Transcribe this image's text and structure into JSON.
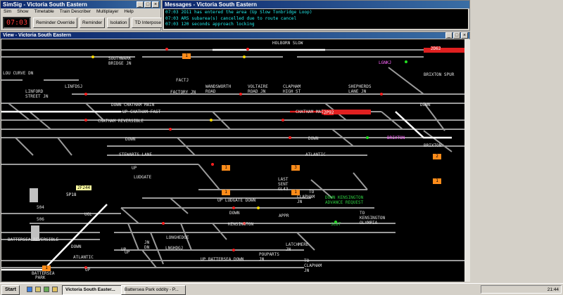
{
  "main_window": {
    "title": "SimSig - Victoria South Eastern",
    "menu": [
      "Sim",
      "Show",
      "Timetable",
      "Train Describer",
      "Multiplayer",
      "Help"
    ],
    "clock": "07:03",
    "buttons": [
      "Reminder Override",
      "Reminder",
      "Isolation",
      "TD Interpose"
    ]
  },
  "messages_window": {
    "title": "Messages - Victoria South Eastern",
    "lines": [
      "07:03 2O11 has entered the area (Up Slow Tonbridge Loop)",
      "07:03 AR5 subarea(s) cancelled due to route cancel",
      "07:03 120 seconds approach locking"
    ]
  },
  "view_window": {
    "title": "View - Victoria South Eastern"
  },
  "diagram": {
    "labels": [
      {
        "t": "HOLBORN SLOW",
        "c": ""
      },
      {
        "t": "SOUTHWARK",
        "c": ""
      },
      {
        "t": "BRIDGE JN",
        "c": ""
      },
      {
        "t": "LGNKJ",
        "c": "m"
      },
      {
        "t": "BRIXTON SPUR",
        "c": ""
      },
      {
        "t": "LOU CURVE DN",
        "c": ""
      },
      {
        "t": "FACTJ",
        "c": ""
      },
      {
        "t": "LINFDSJ",
        "c": ""
      },
      {
        "t": "LINFORD",
        "c": ""
      },
      {
        "t": "STREET JN",
        "c": ""
      },
      {
        "t": "FACTORY JN",
        "c": ""
      },
      {
        "t": "WANDSWORTH",
        "c": ""
      },
      {
        "t": "ROAD",
        "c": ""
      },
      {
        "t": "VOLTAIRE",
        "c": ""
      },
      {
        "t": "ROAD JN",
        "c": ""
      },
      {
        "t": "CLAPHAM",
        "c": ""
      },
      {
        "t": "HIGH ST",
        "c": ""
      },
      {
        "t": "SHEPHERDS",
        "c": ""
      },
      {
        "t": "LANE JN",
        "c": ""
      },
      {
        "t": "DOWN CHATHAM MAIN",
        "c": ""
      },
      {
        "t": "DOWN",
        "c": ""
      },
      {
        "t": "UP CHATHAM FAST",
        "c": ""
      },
      {
        "t": "CHATHAM MAIN",
        "c": ""
      },
      {
        "t": "CHATHAM REVERSIBLE",
        "c": ""
      },
      {
        "t": "DOWN",
        "c": ""
      },
      {
        "t": "DOWN",
        "c": ""
      },
      {
        "t": "BRIXTON",
        "c": "m"
      },
      {
        "t": "BRIXTON",
        "c": ""
      },
      {
        "t": "STEWARTS LANE",
        "c": ""
      },
      {
        "t": "ATLANTIC",
        "c": ""
      },
      {
        "t": "UP",
        "c": ""
      },
      {
        "t": "LUDGATE",
        "c": ""
      },
      {
        "t": "LAST",
        "c": ""
      },
      {
        "t": "SENT",
        "c": ""
      },
      {
        "t": "GL43",
        "c": ""
      },
      {
        "t": "TO",
        "c": ""
      },
      {
        "t": "CLAPHAM",
        "c": ""
      },
      {
        "t": "JN",
        "c": ""
      },
      {
        "t": "DOWN KENSINGTON",
        "c": "g"
      },
      {
        "t": "ADVANCE REQUEST",
        "c": "g"
      },
      {
        "t": "UP LUDGATE DOWN",
        "c": ""
      },
      {
        "t": "APPR",
        "c": ""
      },
      {
        "t": "504",
        "c": ""
      },
      {
        "t": "UGL",
        "c": ""
      },
      {
        "t": "DOWN",
        "c": ""
      },
      {
        "t": "TO",
        "c": ""
      },
      {
        "t": "KENSINGTON",
        "c": ""
      },
      {
        "t": "OLYMPIA",
        "c": ""
      },
      {
        "t": "506",
        "c": ""
      },
      {
        "t": "KENSINGTON",
        "c": ""
      },
      {
        "t": "SLDT",
        "c": "g"
      },
      {
        "t": "BATTERSEA REVERSIBLE",
        "c": ""
      },
      {
        "t": "LONGHEDGE",
        "c": ""
      },
      {
        "t": "JN",
        "c": ""
      },
      {
        "t": "DN",
        "c": ""
      },
      {
        "t": "UP",
        "c": ""
      },
      {
        "t": "LATCHMERE",
        "c": ""
      },
      {
        "t": "JN",
        "c": ""
      },
      {
        "t": "LNGHDGJ",
        "c": ""
      },
      {
        "t": "DOWN",
        "c": ""
      },
      {
        "t": "UP",
        "c": ""
      },
      {
        "t": "ATLANTIC",
        "c": ""
      },
      {
        "t": "UP BATTERSEA DOWN",
        "c": ""
      },
      {
        "t": "POUPARTS",
        "c": ""
      },
      {
        "t": "JN",
        "c": ""
      },
      {
        "t": "TO",
        "c": ""
      },
      {
        "t": "CLAPHAM",
        "c": ""
      },
      {
        "t": "JN",
        "c": ""
      },
      {
        "t": "UP",
        "c": ""
      },
      {
        "t": "BATTERSEA",
        "c": ""
      },
      {
        "t": "PARK",
        "c": ""
      }
    ],
    "berths": [
      "1",
      "2",
      "1",
      "3",
      "1",
      "1",
      "1",
      "1",
      "2",
      "1"
    ],
    "train_ids": [
      "2D62",
      "2P92",
      "5P18"
    ],
    "tooltip": "2F244"
  },
  "taskbar": {
    "start": "Start",
    "tasks": [
      "Victoria South Easter...",
      "Battersea Park oddity - P..."
    ],
    "time": "21:44"
  },
  "colors": {
    "track": "#9a9a9a",
    "route_set": "#ffffff",
    "occupied": "#e02020",
    "signal_red": "#ff2020",
    "signal_green": "#22dd22",
    "berth": "#ff8c1a"
  }
}
